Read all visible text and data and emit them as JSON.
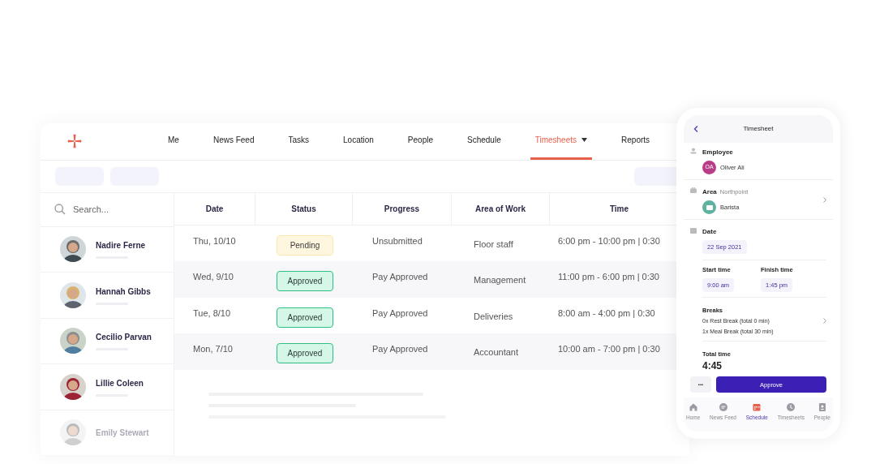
{
  "nav": {
    "items": [
      {
        "label": "Me",
        "selected": false,
        "dropdown": false
      },
      {
        "label": "News Feed",
        "selected": false,
        "dropdown": false
      },
      {
        "label": "Tasks",
        "selected": false,
        "dropdown": false
      },
      {
        "label": "Location",
        "selected": false,
        "dropdown": false
      },
      {
        "label": "People",
        "selected": false,
        "dropdown": false
      },
      {
        "label": "Schedule",
        "selected": false,
        "dropdown": false
      },
      {
        "label": "Timesheets",
        "selected": true,
        "dropdown": true
      },
      {
        "label": "Reports",
        "selected": false,
        "dropdown": false
      }
    ]
  },
  "search": {
    "placeholder": "Search..."
  },
  "people": [
    {
      "name": "Nadire Ferne",
      "faded": false
    },
    {
      "name": "Hannah Gibbs",
      "faded": false
    },
    {
      "name": "Cecilio Parvan",
      "faded": false
    },
    {
      "name": "Lillie Coleen",
      "faded": false
    },
    {
      "name": "Emily Stewart",
      "faded": true
    }
  ],
  "table": {
    "columns": [
      "Date",
      "Status",
      "Progress",
      "Area of Work",
      "Time"
    ],
    "rows": [
      {
        "date": "Thu, 10/10",
        "status": {
          "label": "Pending",
          "kind": "pending"
        },
        "progress": "Unsubmitted",
        "area": "Floor staff",
        "time": "6:00 pm - 10:00 pm | 0:30"
      },
      {
        "date": "Wed, 9/10",
        "status": {
          "label": "Approved",
          "kind": "approved"
        },
        "progress": "Pay Approved",
        "area": "Management",
        "time": "11:00 pm - 6:00 pm | 0:30"
      },
      {
        "date": "Tue, 8/10",
        "status": {
          "label": "Approved",
          "kind": "approved"
        },
        "progress": "Pay Approved",
        "area": "Deliveries",
        "time": "8:00 am - 4:00 pm | 0:30"
      },
      {
        "date": "Mon, 7/10",
        "status": {
          "label": "Approved",
          "kind": "approved"
        },
        "progress": "Pay Approved",
        "area": "Accountant",
        "time": "10:00 am - 7:00 pm | 0:30"
      }
    ]
  },
  "phone": {
    "title": "Timesheet",
    "employee": {
      "label": "Employee",
      "initials": "OA",
      "name": "Oliver Ali"
    },
    "area": {
      "label": "Area",
      "location": "Northpoint",
      "role": "Barista"
    },
    "date": {
      "label": "Date",
      "value": "22 Sep 2021"
    },
    "start": {
      "label": "Start time",
      "value": "9:00 am"
    },
    "finish": {
      "label": "Finish time",
      "value": "1:45 pm"
    },
    "breaks": {
      "label": "Breaks",
      "lines": [
        "0x Rest Break (total 0 min)",
        "1x Meal Break (total 30 min)"
      ]
    },
    "total": {
      "label": "Total time",
      "value": "4:45"
    },
    "more": "•••",
    "approve": "Approve",
    "tabs": [
      {
        "label": "Home",
        "kind": "home",
        "selected": false
      },
      {
        "label": "News Feed",
        "kind": "chat",
        "selected": false
      },
      {
        "label": "Schedule",
        "kind": "calendar",
        "selected": true
      },
      {
        "label": "Timesheets",
        "kind": "clock",
        "selected": false
      },
      {
        "label": "People",
        "kind": "contact",
        "selected": false
      }
    ]
  }
}
